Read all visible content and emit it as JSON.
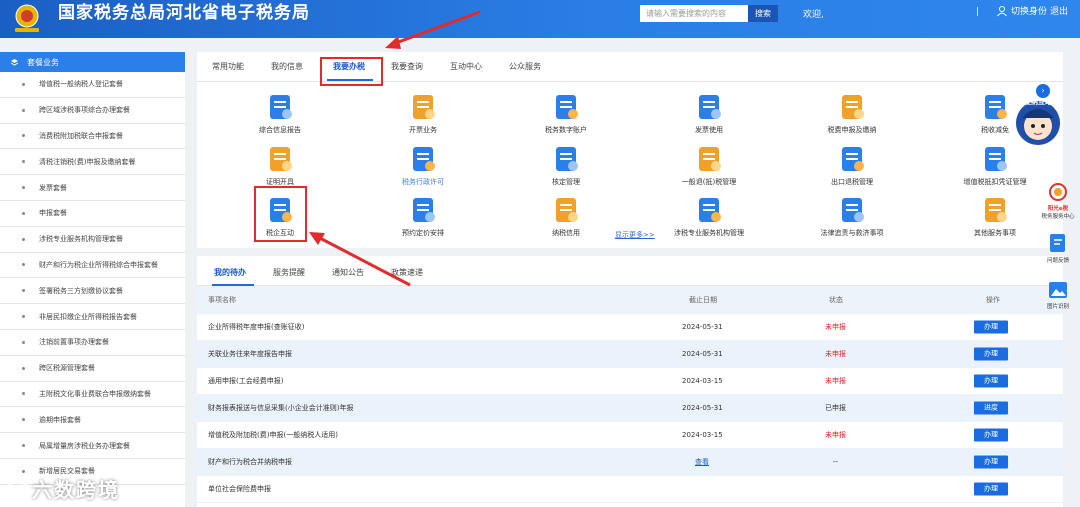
{
  "header": {
    "title": "国家税务总局河北省电子税务局",
    "search_placeholder": "请输入需要搜索的内容",
    "search_button": "搜索",
    "welcome": "欢迎,",
    "separator": "|",
    "switch_label": "切换身份",
    "logout_label": "退出"
  },
  "sidebar": {
    "title": "套餐业务",
    "items": [
      "增值税一般纳税人登记套餐",
      "跨区域涉税事项综合办理套餐",
      "消费税附加税联合申报套餐",
      "清税注销税(费)申报及缴纳套餐",
      "发票套餐",
      "申报套餐",
      "涉税专业服务机构管理套餐",
      "财产和行为税企业所得税综合申报套餐",
      "签署税务三方划缴协议套餐",
      "非居民扣缴企业所得税报告套餐",
      "注销前置事项办理套餐",
      "跨区税源管理套餐",
      "主附税文化事业费联合申报缴纳套餐",
      "逾期申报套餐",
      "局属增量房涉税业务办理套餐",
      "新增居民交易套餐"
    ]
  },
  "main_tabs": [
    "常用功能",
    "我的信息",
    "我要办税",
    "我要查询",
    "互动中心",
    "公众服务"
  ],
  "services": [
    {
      "label": "综合信息报告",
      "icon": "report-doc-icon"
    },
    {
      "label": "开票业务",
      "icon": "invoice-search-icon"
    },
    {
      "label": "税务数字账户",
      "icon": "digital-account-icon"
    },
    {
      "label": "发票使用",
      "icon": "invoice-use-icon"
    },
    {
      "label": "税费申报及缴纳",
      "icon": "tax-payment-icon"
    },
    {
      "label": "税收减免",
      "icon": "tax-reduction-icon"
    },
    {
      "label": "证明开具",
      "icon": "certificate-icon"
    },
    {
      "label": "税务行政许可",
      "icon": "admin-license-icon"
    },
    {
      "label": "核定管理",
      "icon": "assessment-icon"
    },
    {
      "label": "一般退(抵)税管理",
      "icon": "refund-icon"
    },
    {
      "label": "出口退税管理",
      "icon": "export-refund-icon"
    },
    {
      "label": "增值税抵扣凭证管理",
      "icon": "deduction-voucher-icon"
    },
    {
      "label": "税企互动",
      "icon": "tax-interaction-icon"
    },
    {
      "label": "预约定价安排",
      "icon": "pricing-schedule-icon"
    },
    {
      "label": "纳税信用",
      "icon": "tax-credit-icon"
    },
    {
      "label": "涉税专业服务机构管理",
      "icon": "agency-management-icon"
    },
    {
      "label": "法律追责与救济事项",
      "icon": "legal-hammer-icon"
    },
    {
      "label": "其他服务事项",
      "icon": "other-services-icon"
    }
  ],
  "show_more": "显示更多>>",
  "todo": {
    "tabs": [
      "我的待办",
      "服务提醒",
      "通知公告",
      "政策速递"
    ],
    "columns": [
      "事项名称",
      "截止日期",
      "状态",
      "操作"
    ],
    "rows": [
      {
        "name": "企业所得税年度申报(查账征收)",
        "date": "2024-05-31",
        "status": "未申报",
        "status_color": "#e02020",
        "op": "办理",
        "op_type": "button"
      },
      {
        "name": "关联业务往来年度报告申报",
        "date": "2024-05-31",
        "status": "未申报",
        "status_color": "#e02020",
        "op": "办理",
        "op_type": "button"
      },
      {
        "name": "通用申报(工会经费申报)",
        "date": "2024-03-15",
        "status": "未申报",
        "status_color": "#e02020",
        "op": "办理",
        "op_type": "button"
      },
      {
        "name": "财务报表报送与信息采集(小企业会计准则)年报",
        "date": "2024-05-31",
        "status": "已申报",
        "status_color": "#333333",
        "op": "进度",
        "op_type": "button"
      },
      {
        "name": "增值税及附加税(费)申报(一般纳税人适用)",
        "date": "2024-03-15",
        "status": "未申报",
        "status_color": "#e02020",
        "op": "办理",
        "op_type": "button"
      },
      {
        "name": "财产和行为税合并纳税申报",
        "date": "查看",
        "status": "--",
        "status_color": "#333333",
        "op": "办理",
        "op_type": "button"
      },
      {
        "name": "单位社会保险费申报",
        "date": "",
        "status": "",
        "status_color": "#333333",
        "op": "办理",
        "op_type": "button"
      }
    ]
  },
  "float_icons": {
    "avatar_label": "征纳互动",
    "brand_name": "阳光e税",
    "brand_sub": "税务服务中心",
    "feedback": "问题反馈",
    "screenshot": "图片识别"
  },
  "watermark": "六数跨境",
  "colors": {
    "brand_blue": "#1a6de0",
    "highlight_red": "#e22b2b",
    "status_red": "#e02020"
  }
}
